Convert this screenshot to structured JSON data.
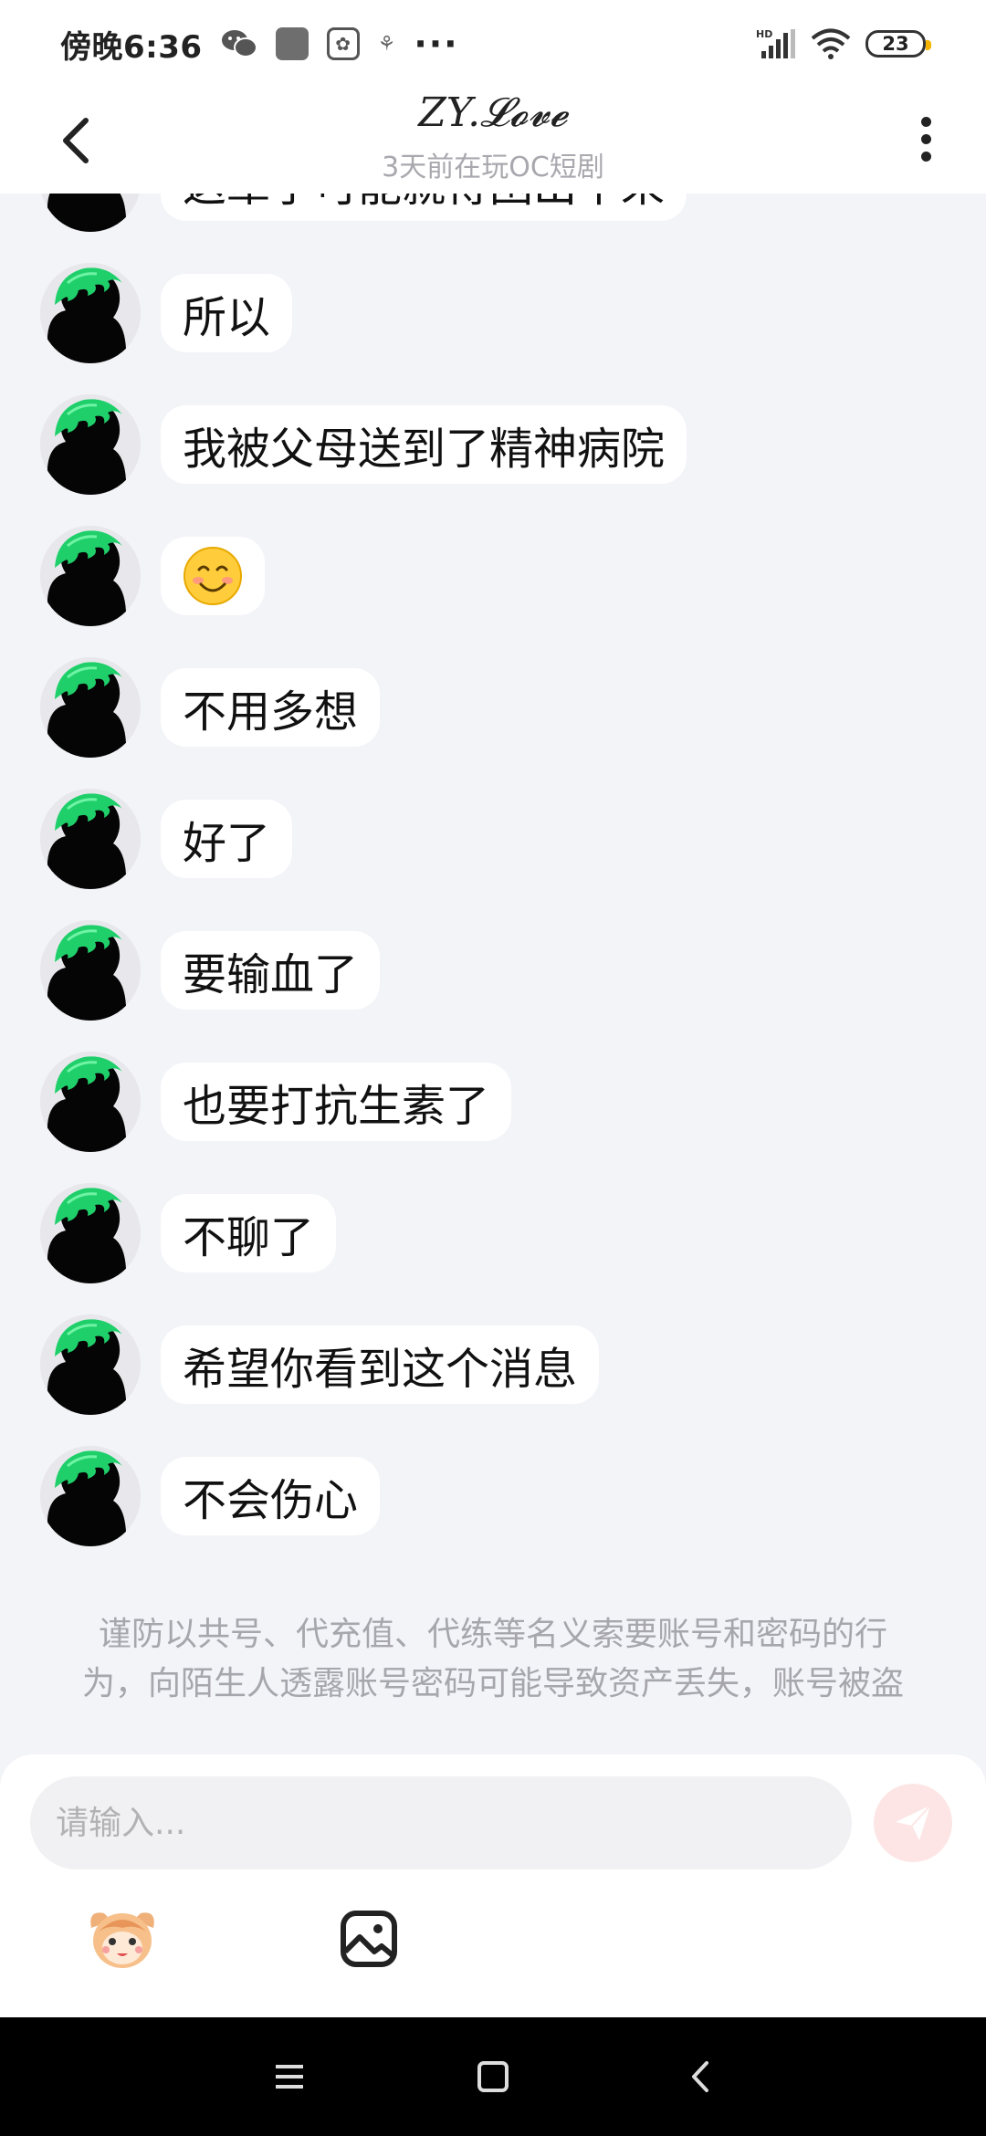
{
  "status_bar": {
    "time": "傍晚6:36",
    "icons": [
      "wechat-icon",
      "app-square-icon",
      "paw-icon",
      "small-app-icon",
      "more-dots-icon",
      "hd-signal-icon",
      "wifi-icon",
      "battery-icon"
    ],
    "dots": "···",
    "hd_label": "HD",
    "battery": "23"
  },
  "header": {
    "title": "ZY.𝓛𝓸𝓿𝓮",
    "subtitle": "3天前在玩OC短剧",
    "icons": [
      "back-icon",
      "more-vertical-icon"
    ]
  },
  "messages": [
    {
      "text": "所以"
    },
    {
      "text": "我被父母送到了精神病院"
    },
    {
      "text": "",
      "emoji": "smiling-face-icon"
    },
    {
      "text": "不用多想"
    },
    {
      "text": "好了"
    },
    {
      "text": "要输血了"
    },
    {
      "text": "也要打抗生素了"
    },
    {
      "text": "不聊了"
    },
    {
      "text": "希望你看到这个消息"
    },
    {
      "text": "不会伤心"
    }
  ],
  "partial_message": {
    "text": "这辈子可能就得困出不来"
  },
  "safety_note": "谨防以共号、代充值、代练等名义索要账号和密码的行为，向陌生人透露账号密码可能导致资产丢失，账号被盗",
  "composer": {
    "placeholder": "请输入...",
    "icons": [
      "send-icon",
      "mascot-sticker-icon",
      "image-icon"
    ]
  },
  "nav": {
    "icons": [
      "menu-icon",
      "home-square-icon",
      "back-triangle-icon"
    ]
  },
  "colors": {
    "background": "#f3f4f8",
    "bubble": "#ffffff",
    "avatar_hair": "#1fcf6a",
    "send_button": "#fde5e5",
    "hint_text": "#a6a6ac"
  }
}
